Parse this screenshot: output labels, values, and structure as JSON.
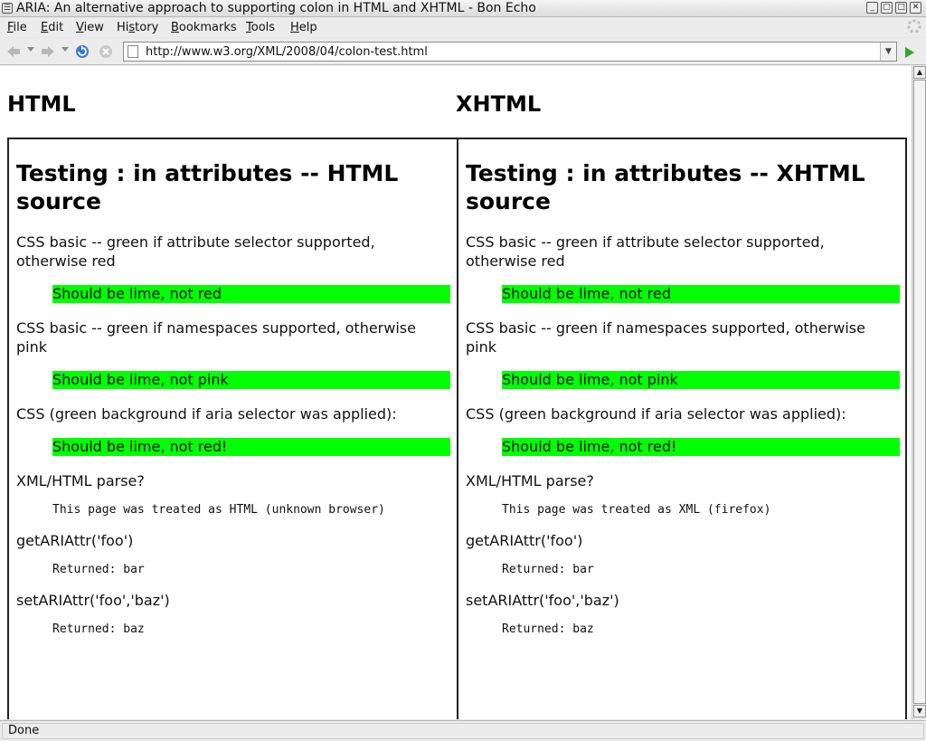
{
  "window": {
    "title": "ARIA: An alternative approach to supporting colon in HTML and XHTML - Bon Echo",
    "sys_glyph": "☰",
    "minimize": "_",
    "maximize": "□",
    "restore": "▢",
    "close": "✕"
  },
  "menu": {
    "file": {
      "u": "F",
      "rest": "ile"
    },
    "edit": {
      "u": "E",
      "rest": "dit"
    },
    "view": {
      "u": "V",
      "rest": "iew"
    },
    "history": {
      "pre": "Hi",
      "u": "s",
      "rest": "tory"
    },
    "bookmarks": {
      "u": "B",
      "rest": "ookmarks"
    },
    "tools": {
      "u": "T",
      "rest": "ools"
    },
    "help": {
      "u": "H",
      "rest": "elp"
    }
  },
  "toolbar": {
    "back_icon": "back-arrow",
    "forward_icon": "forward-arrow",
    "reload_icon": "reload",
    "stop_icon": "stop",
    "url": "http://www.w3.org/XML/2008/04/colon-test.html",
    "go_icon": "go-arrow"
  },
  "columns": [
    {
      "header": "HTML",
      "heading": "Testing : in attributes -- HTML source",
      "p1": "CSS basic -- green if attribute selector supported, otherwise red",
      "lime1": "Should be lime, not red",
      "p2": "CSS basic -- green if namespaces supported, otherwise pink",
      "lime2": "Should be lime, not pink",
      "p3": "CSS (green background if aria selector was applied):",
      "lime3": "Should be lime, not red!",
      "p4": "XML/HTML parse?",
      "mono1": "This page was treated as HTML (unknown browser)",
      "p5": "getARIAttr('foo')",
      "mono2": "Returned: bar",
      "p6": "setARIAttr('foo','baz')",
      "mono3": "Returned: baz"
    },
    {
      "header": "XHTML",
      "heading": "Testing : in attributes -- XHTML source",
      "p1": "CSS basic -- green if attribute selector supported, otherwise red",
      "lime1": "Should be lime, not red",
      "p2": "CSS basic -- green if namespaces supported, otherwise pink",
      "lime2": "Should be lime, not pink",
      "p3": "CSS (green background if aria selector was applied):",
      "lime3": "Should be lime, not red!",
      "p4": "XML/HTML parse?",
      "mono1": "This page was treated as XML (firefox)",
      "p5": "getARIAttr('foo')",
      "mono2": "Returned: bar",
      "p6": "setARIAttr('foo','baz')",
      "mono3": "Returned: baz"
    }
  ],
  "status": {
    "text": "Done"
  },
  "colors": {
    "lime": "#00ff00"
  }
}
